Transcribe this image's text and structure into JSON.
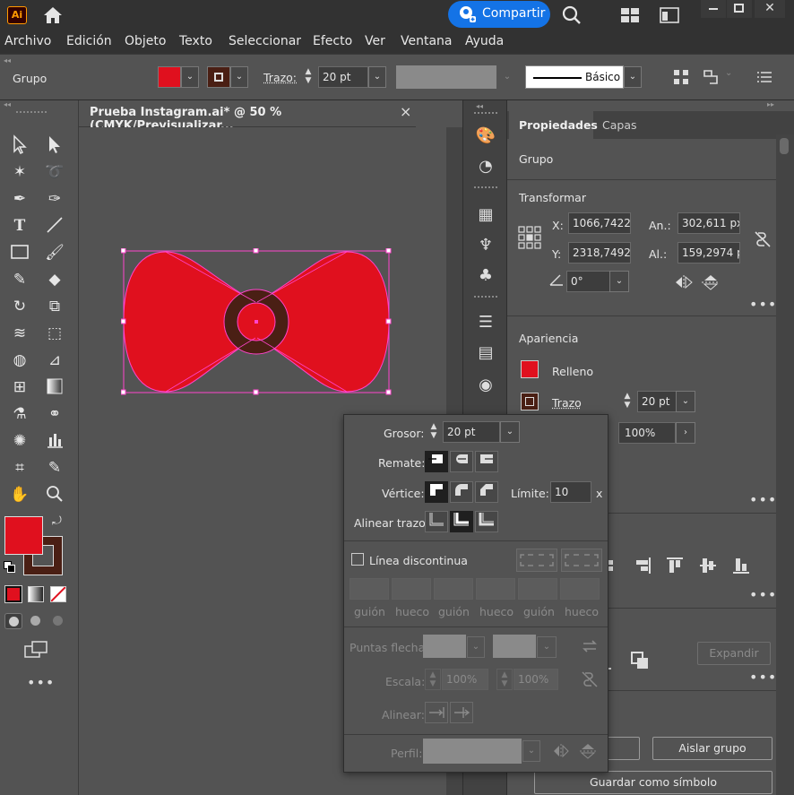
{
  "app": {
    "logo": "Ai",
    "share_label": "Compartir"
  },
  "menu": [
    "Archivo",
    "Edición",
    "Objeto",
    "Texto",
    "Seleccionar",
    "Efecto",
    "Ver",
    "Ventana",
    "Ayuda"
  ],
  "control": {
    "selection_label": "Grupo",
    "trazo_label": "Trazo:",
    "stroke_weight": "20 pt",
    "brush_label": "Básico"
  },
  "document": {
    "tab_title": "Prueba Instagram.ai* @ 50 % (CMYK/Previsualizar...",
    "close": "×"
  },
  "properties": {
    "tabs": [
      "Propiedades",
      "Capas"
    ],
    "object_type": "Grupo",
    "transform_title": "Transformar",
    "x_label": "X:",
    "x_value": "1066,7422",
    "y_label": "Y:",
    "y_value": "2318,7492",
    "w_label": "An.:",
    "w_value": "302,611 px",
    "h_label": "Al.:",
    "h_value": "159,2974 p",
    "angle_value": "0°",
    "appearance_title": "Apariencia",
    "fill_label": "Relleno",
    "stroke_label": "Trazo",
    "stroke_value": "20 pt",
    "opacity_value": "100%",
    "expand_button": "Expandir",
    "isolate_button": "Aislar grupo",
    "save_symbol_button": "Guardar como símbolo"
  },
  "stroke_popup": {
    "weight_label": "Grosor:",
    "weight_value": "20 pt",
    "cap_label": "Remate:",
    "corner_label": "Vértice:",
    "limit_label": "Límite:",
    "limit_value": "10",
    "limit_unit": "x",
    "align_label": "Alinear trazo:",
    "dashed_label": "Línea discontinua",
    "dash_labels": [
      "guión",
      "hueco",
      "guión",
      "hueco",
      "guión",
      "hueco"
    ],
    "arrowheads_label": "Puntas flecha:",
    "scale_label": "Escala:",
    "scale_value_1": "100%",
    "scale_value_2": "100%",
    "align2_label": "Alinear:",
    "profile_label": "Perfil:"
  },
  "colors": {
    "fill": "#E0101E",
    "stroke": "#4A1F14",
    "selection": "#FF33CC",
    "share_blue": "#1473E6"
  }
}
